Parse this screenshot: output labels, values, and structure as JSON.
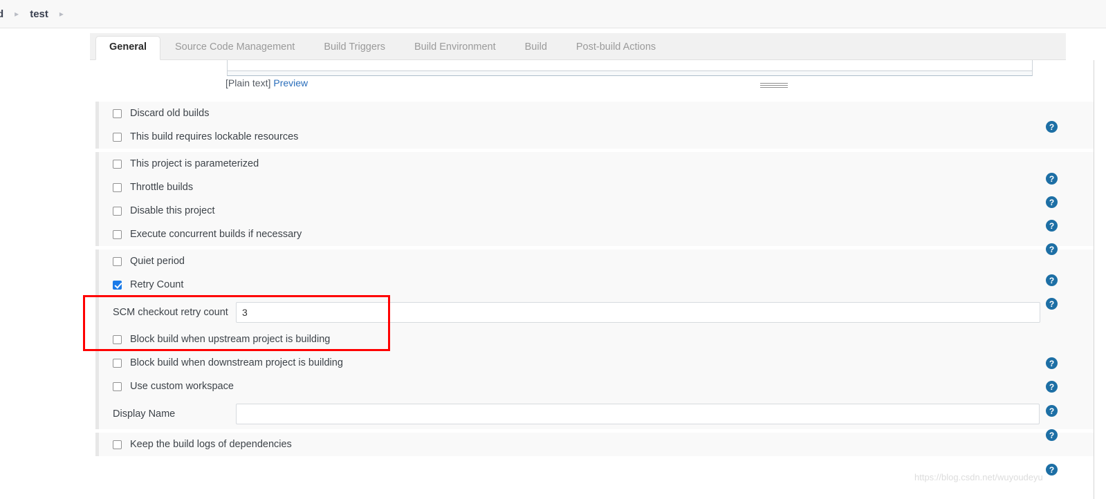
{
  "breadcrumb": {
    "items": [
      {
        "label": "d",
        "clipped": true
      },
      {
        "label": "test",
        "clipped": false
      }
    ],
    "separator": "▸"
  },
  "tabs": [
    {
      "label": "General",
      "active": true
    },
    {
      "label": "Source Code Management",
      "active": false
    },
    {
      "label": "Build Triggers",
      "active": false
    },
    {
      "label": "Build Environment",
      "active": false
    },
    {
      "label": "Build",
      "active": false
    },
    {
      "label": "Post-build Actions",
      "active": false
    }
  ],
  "description_area": {
    "format_label": "[Plain text]",
    "preview_link": "Preview"
  },
  "groups": [
    {
      "rows": [
        {
          "kind": "checkbox",
          "label": "Discard old builds",
          "checked": false,
          "help": true
        },
        {
          "kind": "checkbox",
          "label": "This build requires lockable resources",
          "checked": false,
          "help": false
        }
      ]
    },
    {
      "rows": [
        {
          "kind": "checkbox",
          "label": "This project is parameterized",
          "checked": false,
          "help": true
        },
        {
          "kind": "checkbox",
          "label": "Throttle builds",
          "checked": false,
          "help": true
        },
        {
          "kind": "checkbox",
          "label": "Disable this project",
          "checked": false,
          "help": true
        },
        {
          "kind": "checkbox",
          "label": "Execute concurrent builds if necessary",
          "checked": false,
          "help": true
        }
      ]
    },
    {
      "rows": [
        {
          "kind": "checkbox",
          "label": "Quiet period",
          "checked": false,
          "help": true
        },
        {
          "kind": "checkbox",
          "label": "Retry Count",
          "checked": true,
          "help": true
        },
        {
          "kind": "field",
          "label": "SCM checkout retry count",
          "value": "3",
          "placeholder": "",
          "help": false
        },
        {
          "kind": "checkbox",
          "label": "Block build when upstream project is building",
          "checked": false,
          "help": true
        },
        {
          "kind": "checkbox",
          "label": "Block build when downstream project is building",
          "checked": false,
          "help": true
        },
        {
          "kind": "checkbox",
          "label": "Use custom workspace",
          "checked": false,
          "help": true
        },
        {
          "kind": "field",
          "label": "Display Name",
          "value": "",
          "placeholder": "",
          "help": true
        }
      ]
    },
    {
      "rows": [
        {
          "kind": "checkbox",
          "label": "Keep the build logs of dependencies",
          "checked": false,
          "help": true
        }
      ]
    }
  ],
  "annotation": {
    "color": "#ff0000",
    "targets": [
      "Retry Count",
      "SCM checkout retry count"
    ]
  },
  "watermark": "https://blog.csdn.net/wuyoudeyu",
  "colors": {
    "checkbox_checked": "#1a7ae8",
    "help_icon": "#1d6fa5",
    "link": "#2a6ebb",
    "annotation": "#ff0000",
    "group_bg": "#f9f9f9",
    "tabbar_bg": "#f1f1f1"
  }
}
